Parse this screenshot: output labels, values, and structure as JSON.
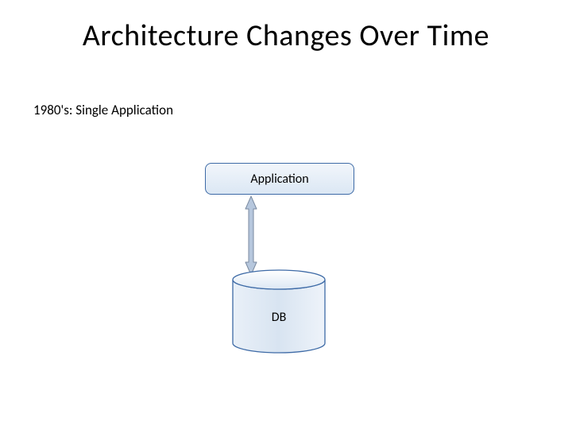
{
  "title": "Architecture Changes Over Time",
  "subtitle": "1980's: Single Application",
  "nodes": {
    "application": {
      "label": "Application"
    },
    "database": {
      "label": "DB"
    }
  },
  "colors": {
    "box_border": "#3d6aa6",
    "box_fill_top": "#f2f6fb",
    "box_fill_bottom": "#dbe7f4",
    "arrow_fill": "#b6c7dd",
    "arrow_stroke": "#7a8aa0",
    "db_stroke": "#3d6aa6",
    "db_fill_light": "#f5f8fc",
    "db_fill_dark": "#d8e4f1"
  }
}
